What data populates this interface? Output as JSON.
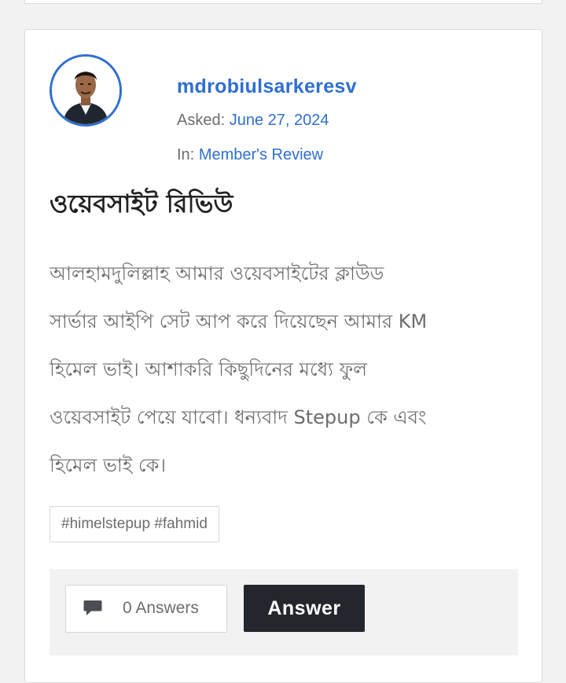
{
  "question": {
    "author": "mdrobiulsarkeresv",
    "asked_label": "Asked:",
    "asked_date": "June 27, 2024",
    "category_label": "In:",
    "category": "Member's Review",
    "title": "ওয়েবসাইট রিভিউ",
    "body_lines": [
      "আলহামদুলিল্লাহ আমার ওয়েবসাইটের ক্লাউড",
      "সার্ভার আইপি সেট আপ করে দিয়েছেন আমার KM",
      "হিমেল ভাই। আশাকরি কিছুদিনের মধ্যে ফুল",
      "ওয়েবসাইট পেয়ে যাবো। ধন্যবাদ Stepup কে এবং",
      "হিমেল ভাই কে।"
    ],
    "tags": "#himelstepup #fahmid"
  },
  "footer": {
    "answers_count": "0 Answers",
    "answer_button": "Answer"
  },
  "colors": {
    "accent": "#2f6fd0",
    "button_dark": "#23262d",
    "muted_text": "#6d6d6d"
  },
  "icons": {
    "comments": "speech-bubble-icon"
  }
}
